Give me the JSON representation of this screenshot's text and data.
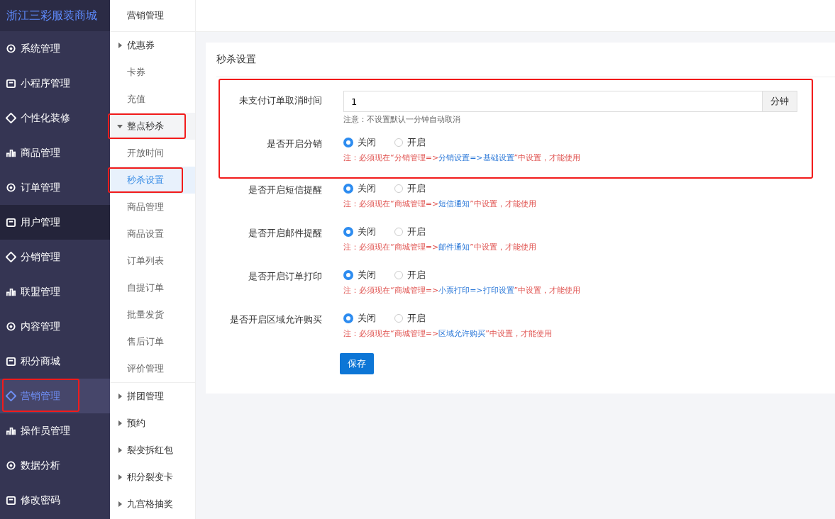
{
  "sidebar": {
    "brand": "浙江三彩服装商城",
    "items": [
      {
        "label": "系统管理",
        "selected": false,
        "hovered": false,
        "highlighted": false
      },
      {
        "label": "小程序管理",
        "selected": false,
        "hovered": false,
        "highlighted": false
      },
      {
        "label": "个性化装修",
        "selected": false,
        "hovered": false,
        "highlighted": false
      },
      {
        "label": "商品管理",
        "selected": false,
        "hovered": false,
        "highlighted": false
      },
      {
        "label": "订单管理",
        "selected": false,
        "hovered": false,
        "highlighted": false
      },
      {
        "label": "用户管理",
        "selected": false,
        "hovered": true,
        "highlighted": false
      },
      {
        "label": "分销管理",
        "selected": false,
        "hovered": false,
        "highlighted": false
      },
      {
        "label": "联盟管理",
        "selected": false,
        "hovered": false,
        "highlighted": false
      },
      {
        "label": "内容管理",
        "selected": false,
        "hovered": false,
        "highlighted": false
      },
      {
        "label": "积分商城",
        "selected": false,
        "hovered": false,
        "highlighted": false
      },
      {
        "label": "营销管理",
        "selected": true,
        "hovered": false,
        "highlighted": true
      },
      {
        "label": "操作员管理",
        "selected": false,
        "hovered": false,
        "highlighted": false
      },
      {
        "label": "数据分析",
        "selected": false,
        "hovered": false,
        "highlighted": false
      },
      {
        "label": "修改密码",
        "selected": false,
        "hovered": false,
        "highlighted": false
      }
    ]
  },
  "submenu": {
    "title": "营销管理",
    "items": [
      {
        "label": "优惠券",
        "kind": "group",
        "expanded": false,
        "selected": false,
        "highlighted": false
      },
      {
        "label": "卡券",
        "kind": "link",
        "selected": false,
        "highlighted": false
      },
      {
        "label": "充值",
        "kind": "link",
        "selected": false,
        "highlighted": false
      },
      {
        "label": "整点秒杀",
        "kind": "group",
        "expanded": true,
        "selected": false,
        "highlighted": true,
        "children": [
          {
            "label": "开放时间",
            "selected": false,
            "highlighted": false
          },
          {
            "label": "秒杀设置",
            "selected": true,
            "highlighted": true
          },
          {
            "label": "商品管理",
            "selected": false,
            "highlighted": false
          },
          {
            "label": "商品设置",
            "selected": false,
            "highlighted": false
          },
          {
            "label": "订单列表",
            "selected": false,
            "highlighted": false
          },
          {
            "label": "自提订单",
            "selected": false,
            "highlighted": false
          },
          {
            "label": "批量发货",
            "selected": false,
            "highlighted": false
          },
          {
            "label": "售后订单",
            "selected": false,
            "highlighted": false
          },
          {
            "label": "评价管理",
            "selected": false,
            "highlighted": false
          }
        ]
      },
      {
        "label": "拼团管理",
        "kind": "group",
        "expanded": false,
        "selected": false,
        "highlighted": false
      },
      {
        "label": "预约",
        "kind": "group",
        "expanded": false,
        "selected": false,
        "highlighted": false
      },
      {
        "label": "裂变拆红包",
        "kind": "group",
        "expanded": false,
        "selected": false,
        "highlighted": false
      },
      {
        "label": "积分裂变卡",
        "kind": "group",
        "expanded": false,
        "selected": false,
        "highlighted": false
      },
      {
        "label": "九宫格抽奖",
        "kind": "group",
        "expanded": false,
        "selected": false,
        "highlighted": false
      }
    ]
  },
  "card": {
    "title": "秒杀设置",
    "fields": [
      {
        "kind": "input",
        "label": "未支付订单取消时间",
        "value": "1",
        "addon": "分钟",
        "hint": "注意：不设置默认一分钟自动取消",
        "highlighted": true
      },
      {
        "kind": "radio",
        "label": "是否开启分销",
        "options": [
          {
            "label": "关闭",
            "selected": true
          },
          {
            "label": "开启",
            "selected": false
          }
        ],
        "note": [
          {
            "text": "注：必须现在“分销管理=>",
            "link": false
          },
          {
            "text": "分销设置=>基础设置",
            "link": true
          },
          {
            "text": "”中设置，才能使用",
            "link": false
          }
        ],
        "highlighted": true
      },
      {
        "kind": "radio",
        "label": "是否开启短信提醒",
        "options": [
          {
            "label": "关闭",
            "selected": true
          },
          {
            "label": "开启",
            "selected": false
          }
        ],
        "note": [
          {
            "text": "注：必须现在“商城管理=>",
            "link": false
          },
          {
            "text": "短信通知",
            "link": true
          },
          {
            "text": "”中设置，才能使用",
            "link": false
          }
        ],
        "highlighted": false
      },
      {
        "kind": "radio",
        "label": "是否开启邮件提醒",
        "options": [
          {
            "label": "关闭",
            "selected": true
          },
          {
            "label": "开启",
            "selected": false
          }
        ],
        "note": [
          {
            "text": "注：必须现在“商城管理=>",
            "link": false
          },
          {
            "text": "邮件通知",
            "link": true
          },
          {
            "text": "”中设置，才能使用",
            "link": false
          }
        ],
        "highlighted": false
      },
      {
        "kind": "radio",
        "label": "是否开启订单打印",
        "options": [
          {
            "label": "关闭",
            "selected": true
          },
          {
            "label": "开启",
            "selected": false
          }
        ],
        "note": [
          {
            "text": "注：必须现在“商城管理=>",
            "link": false
          },
          {
            "text": "小票打印=>打印设置",
            "link": true
          },
          {
            "text": "”中设置，才能使用",
            "link": false
          }
        ],
        "highlighted": false
      },
      {
        "kind": "radio",
        "label": "是否开启区域允许购买",
        "options": [
          {
            "label": "关闭",
            "selected": true
          },
          {
            "label": "开启",
            "selected": false
          }
        ],
        "note": [
          {
            "text": "注：必须现在“商城管理=>",
            "link": false
          },
          {
            "text": "区域允许购买",
            "link": true
          },
          {
            "text": "”中设置，才能使用",
            "link": false
          }
        ],
        "highlighted": false
      }
    ],
    "save_button": "保存"
  }
}
